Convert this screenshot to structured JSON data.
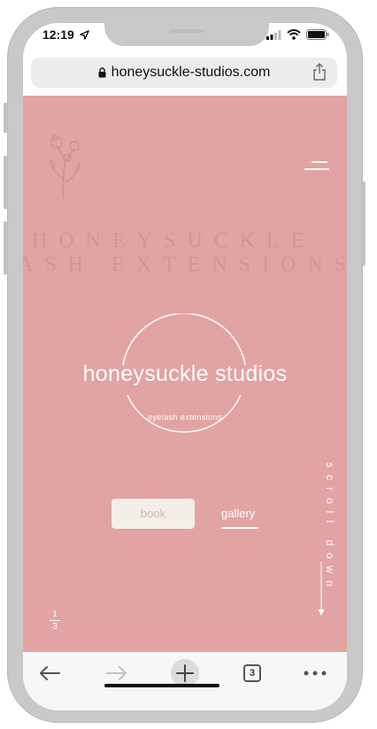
{
  "status_bar": {
    "time": "12:19"
  },
  "browser": {
    "url": "honeysuckle-studios.com",
    "tabs_count": "3"
  },
  "hero": {
    "bg_text_line1": "HONEYSUCKLE",
    "bg_text_line2": "ASH EXTENSIONS",
    "logo_title": "honeysuckle studios",
    "logo_subtitle": "eyelash extensions",
    "book_label": "book",
    "gallery_label": "gallery",
    "scroll_label": "scroll down",
    "page_current": "1",
    "page_total": "3"
  },
  "colors": {
    "hero_bg": "#e2a4a3",
    "bg_text": "#d49494",
    "book_button_bg": "#f3efe8",
    "book_button_text": "#d9b2ae"
  },
  "icons": [
    "location-arrow-icon",
    "signal-icon",
    "wifi-icon",
    "battery-icon",
    "lock-icon",
    "share-icon",
    "flower-logo-icon",
    "menu-icon",
    "back-icon",
    "forward-icon",
    "new-tab-icon",
    "more-icon"
  ]
}
